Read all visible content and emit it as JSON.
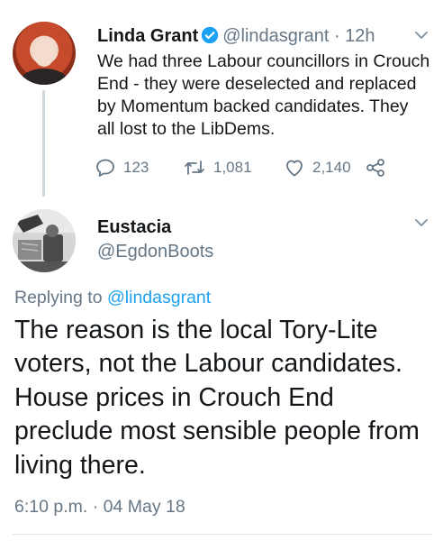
{
  "tweet1": {
    "name": "Linda Grant",
    "handle": "@lindasgrant",
    "time": "12h",
    "body": "We had three Labour councillors in Crouch End - they were deselected and replaced by Momentum backed candidates. They all lost to the LibDems.",
    "reply_count": "123",
    "retweet_count": "1,081",
    "like_count": "2,140"
  },
  "tweet2": {
    "name": "Eustacia",
    "handle": "@EgdonBoots",
    "replying_prefix": "Replying to",
    "replying_to": "@lindasgrant",
    "body": "The reason is the local Tory-Lite voters, not the Labour candidates. House prices in Crouch End preclude most sensible people from living there.",
    "time": "6:10 p.m.",
    "date": "04 May 18"
  },
  "colors": {
    "text": "#14171a",
    "secondary": "#657786",
    "accent": "#1da1f2"
  },
  "icons": [
    "verified-badge-icon",
    "chevron-down-icon",
    "reply-icon",
    "retweet-icon",
    "like-icon",
    "share-icon"
  ]
}
